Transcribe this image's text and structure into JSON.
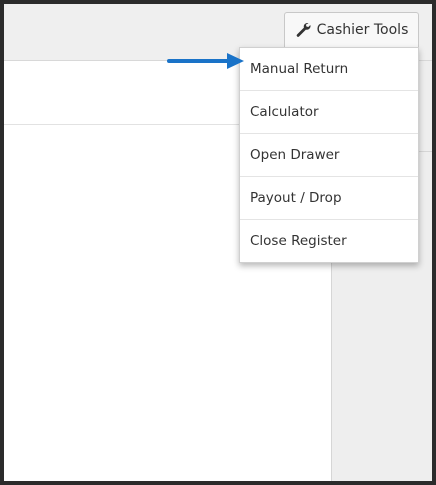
{
  "toolbar": {
    "tools_button_label": "Cashier Tools",
    "tools_icon": "wrench-icon"
  },
  "dropdown": {
    "items": [
      {
        "label": "Manual Return"
      },
      {
        "label": "Calculator"
      },
      {
        "label": "Open Drawer"
      },
      {
        "label": "Payout / Drop"
      },
      {
        "label": "Close Register"
      }
    ]
  },
  "annotation": {
    "arrow_icon": "pointer-arrow-icon",
    "arrow_color": "#1a73c8"
  }
}
